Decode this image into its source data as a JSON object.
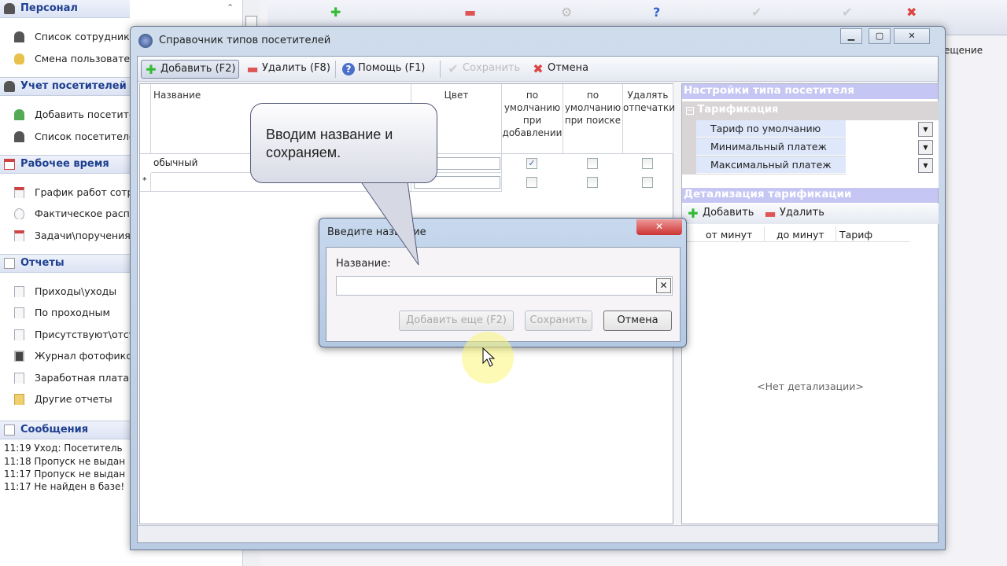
{
  "sidebar": {
    "sections": [
      {
        "label": "Персонал",
        "items": [
          "Список сотрудников",
          "Смена пользователя"
        ]
      },
      {
        "label": "Учет посетителей",
        "items": [
          "Добавить посетителя",
          "Список посетителей"
        ]
      },
      {
        "label": "Рабочее время",
        "items": [
          "График работ сотрудников",
          "Фактическое расписание",
          "Задачи\\поручения"
        ]
      },
      {
        "label": "Отчеты",
        "items": [
          "Приходы\\уходы",
          "По проходным",
          "Присутствуют\\отсутствуют",
          "Журнал фотофиксации",
          "Заработная плата",
          "Другие отчеты"
        ]
      },
      {
        "label": "Сообщения"
      }
    ],
    "messages": [
      "11:19 Уход: Посетитель",
      "11:18 Пропуск не выдан",
      "11:17 Пропуск не выдан",
      "11:17 Не найден в базе!"
    ]
  },
  "app": {
    "column_fragment": "ещение"
  },
  "window": {
    "title": "Справочник типов посетителей",
    "toolbar": {
      "add": "Добавить (F2)",
      "delete": "Удалить (F8)",
      "help": "Помощь (F1)",
      "save": "Сохранить",
      "cancel": "Отмена"
    },
    "grid": {
      "columns": [
        "Название",
        "Цвет",
        "по умолчанию при добавлении",
        "по умолчанию при поиске",
        "Удалять отпечатки"
      ],
      "rows": [
        {
          "name": "обычный",
          "default_add": true,
          "default_search": false,
          "delete_prints": false
        }
      ],
      "new_row_marker": "*"
    },
    "settings": {
      "title": "Настройки типа посетителя",
      "group": "Тарификация",
      "props": [
        "Тариф по умолчанию",
        "Минимальный платеж",
        "Максимальный платеж"
      ],
      "detail_title": "Детализация тарификации",
      "detail_add": "Добавить",
      "detail_delete": "Удалить",
      "detail_columns": [
        "от минут",
        "до минут",
        "Тариф"
      ],
      "empty": "<Нет детализации>"
    }
  },
  "dialog": {
    "title": "Введите название",
    "label": "Название:",
    "value": "",
    "add_more": "Добавить еще (F2)",
    "save": "Сохранить",
    "cancel": "Отмена"
  },
  "callout": {
    "text": "Вводим название и сохраняем."
  }
}
